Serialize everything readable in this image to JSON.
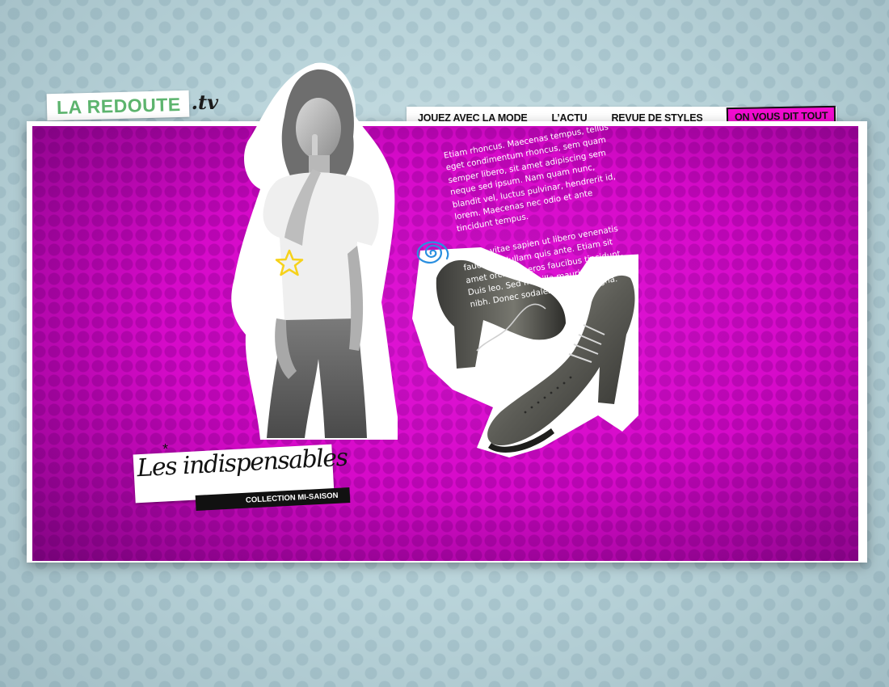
{
  "brand": {
    "name": "LA REDOUTE",
    "suffix": ".tv",
    "color": "#5db46e"
  },
  "nav": {
    "items": [
      {
        "label": "JOUEZ AVEC LA MODE",
        "active": false
      },
      {
        "label": "L’ACTU",
        "active": false
      },
      {
        "label": "REVUE DE STYLES",
        "active": false
      },
      {
        "label": "ON VOUS DIT TOUT",
        "active": true
      }
    ],
    "active_color": "#f20cd0"
  },
  "panel": {
    "background": "#d60ac9",
    "paragraphs": [
      "Etiam rhoncus. Maecenas tempus, tellus eget condimentum rhoncus, sem quam semper libero, sit amet adipiscing sem neque sed ipsum. Nam quam nunc, blandit vel, luctus pulvinar, hendrerit id, lorem. Maecenas nec odio et ante tincidunt tempus.",
      "Donec vitae sapien ut libero venenatis faucibus. Nullam quis ante. Etiam sit amet orci eget eros faucibus tincidunt. Duis leo. Sed fringilla mauris sit amet nibh. Donec sodales sagittis magna."
    ],
    "title": "Les indispensables",
    "subtitle": "COLLECTION MI-SAISON"
  },
  "decorations": {
    "star_icon": "star-doodle-icon",
    "spiral_icon": "spiral-doodle-icon",
    "star_color": "#f6d21a",
    "spiral_color": "#2a8fe0"
  }
}
